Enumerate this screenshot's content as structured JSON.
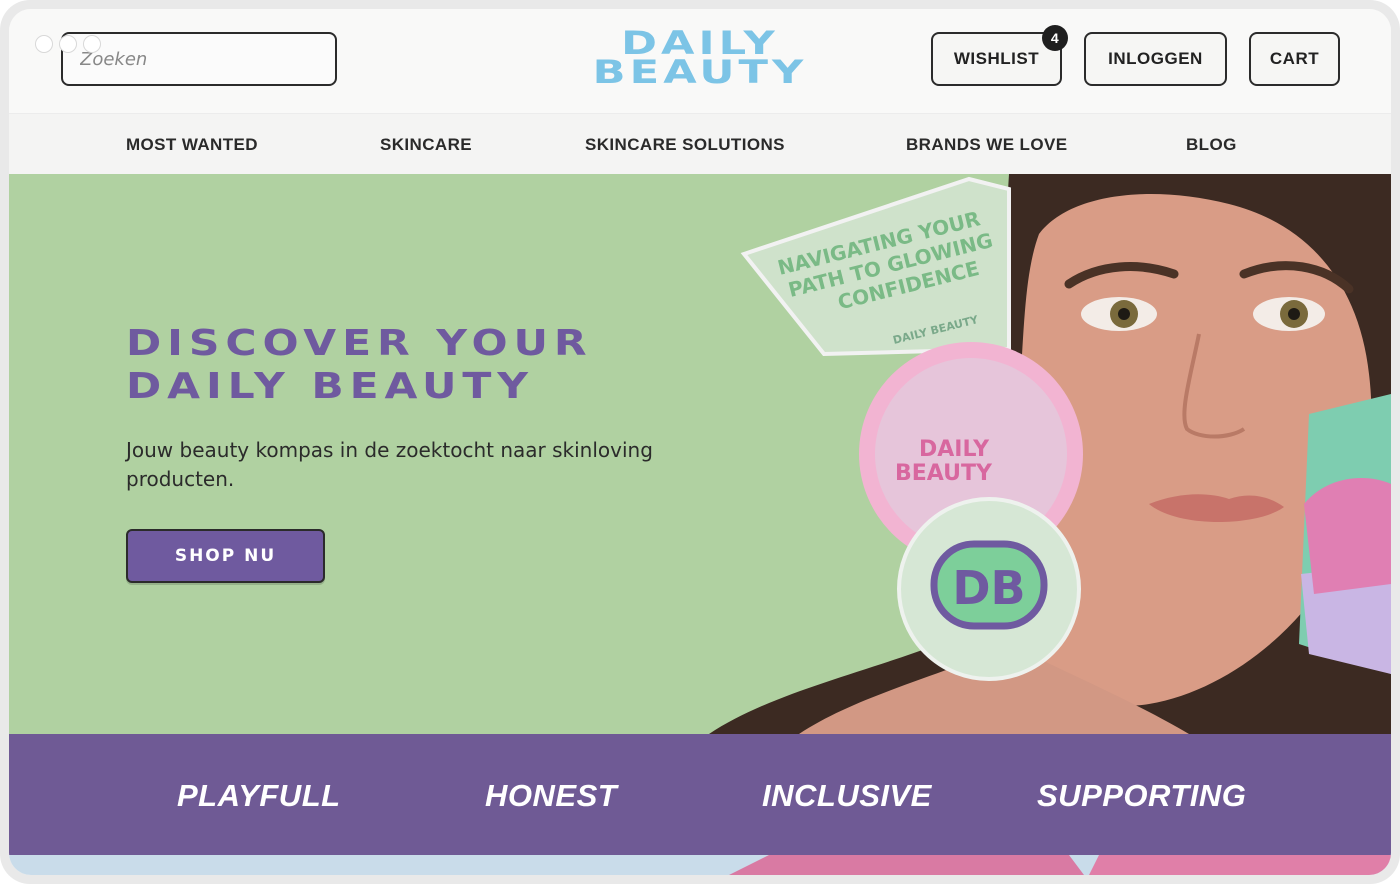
{
  "search": {
    "placeholder": "Zoeken"
  },
  "logo": {
    "line1": "DAILY",
    "line2": "BEAUTY"
  },
  "header_buttons": {
    "wishlist": "WISHLIST",
    "wishlist_count": "4",
    "login": "INLOGGEN",
    "cart": "CART"
  },
  "nav": {
    "items": [
      {
        "label": "MOST WANTED"
      },
      {
        "label": "SKINCARE"
      },
      {
        "label": "SKINCARE SOLUTIONS"
      },
      {
        "label": "BRANDS WE LOVE"
      },
      {
        "label": "BLOG"
      }
    ]
  },
  "hero": {
    "title_line1": "DISCOVER YOUR",
    "title_line2": "DAILY BEAUTY",
    "subtitle": "Jouw beauty kompas in de zoektocht naar skinloving producten.",
    "cta": "SHOP NU",
    "sticker_tag": "NAVIGATING YOUR PATH TO GLOWING CONFIDENCE",
    "sticker_small": "DAILY BEAUTY",
    "sticker_pink": "DAILY BEAUTY",
    "sticker_round": "DB"
  },
  "values": {
    "items": [
      {
        "label": "PLAYFULL"
      },
      {
        "label": "HONEST"
      },
      {
        "label": "INCLUSIVE"
      },
      {
        "label": "SUPPORTING"
      }
    ]
  },
  "colors": {
    "accent_purple": "#6f5a9f",
    "logo_blue": "#7cc4e6",
    "hero_green": "#b0d1a1",
    "band_purple": "#6f5a95"
  }
}
